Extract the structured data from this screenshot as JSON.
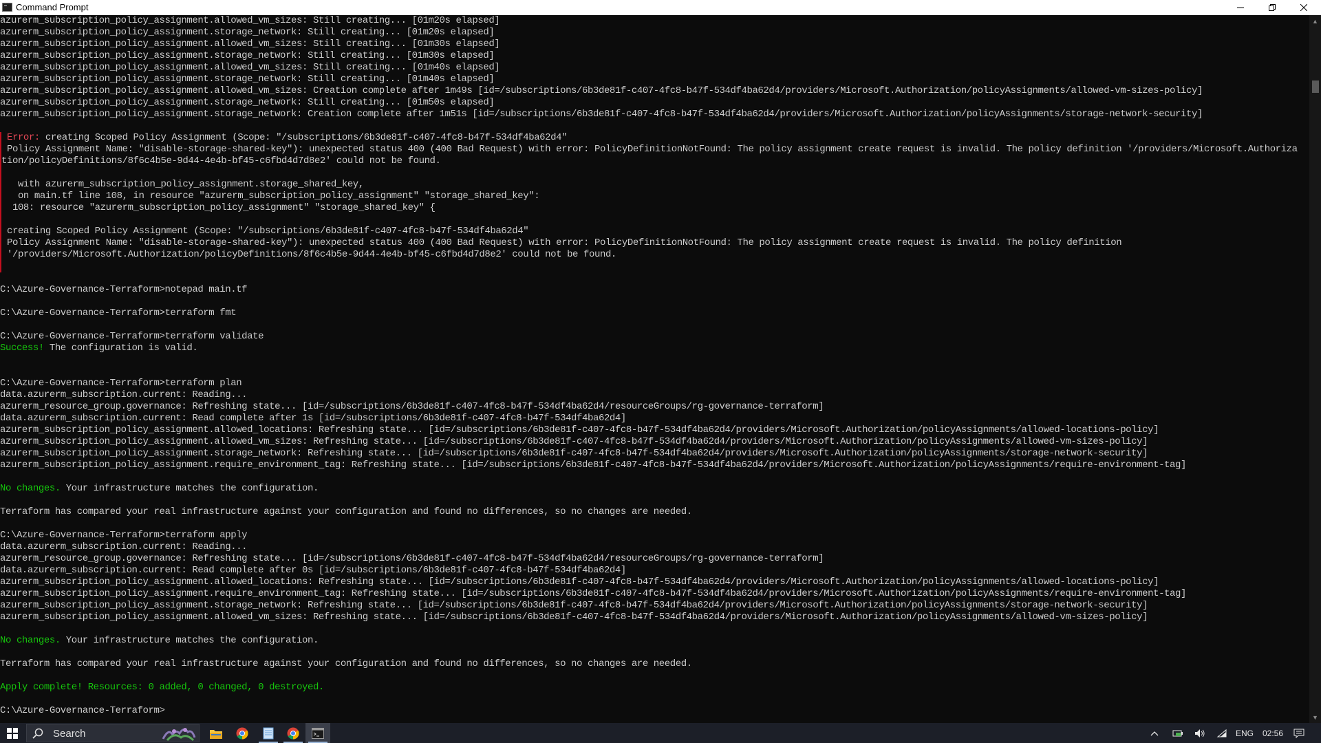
{
  "window": {
    "title": "Command Prompt"
  },
  "console_lines": [
    {
      "segments": [
        {
          "t": "azurerm_subscription_policy_assignment.allowed_vm_sizes: Still creating... [01m20s elapsed]"
        }
      ]
    },
    {
      "segments": [
        {
          "t": "azurerm_subscription_policy_assignment.storage_network: Still creating... [01m20s elapsed]"
        }
      ]
    },
    {
      "segments": [
        {
          "t": "azurerm_subscription_policy_assignment.allowed_vm_sizes: Still creating... [01m30s elapsed]"
        }
      ]
    },
    {
      "segments": [
        {
          "t": "azurerm_subscription_policy_assignment.storage_network: Still creating... [01m30s elapsed]"
        }
      ]
    },
    {
      "segments": [
        {
          "t": "azurerm_subscription_policy_assignment.allowed_vm_sizes: Still creating... [01m40s elapsed]"
        }
      ]
    },
    {
      "segments": [
        {
          "t": "azurerm_subscription_policy_assignment.storage_network: Still creating... [01m40s elapsed]"
        }
      ]
    },
    {
      "segments": [
        {
          "t": "azurerm_subscription_policy_assignment.allowed_vm_sizes: Creation complete after 1m49s [id=/subscriptions/6b3de81f-c407-4fc8-b47f-534df4ba62d4/providers/Microsoft.Authorization/policyAssignments/allowed-vm-sizes-policy]"
        }
      ]
    },
    {
      "segments": [
        {
          "t": "azurerm_subscription_policy_assignment.storage_network: Still creating... [01m50s elapsed]"
        }
      ]
    },
    {
      "segments": [
        {
          "t": "azurerm_subscription_policy_assignment.storage_network: Creation complete after 1m51s [id=/subscriptions/6b3de81f-c407-4fc8-b47f-534df4ba62d4/providers/Microsoft.Authorization/policyAssignments/storage-network-security]"
        }
      ]
    },
    {
      "segments": [
        {
          "t": ""
        }
      ]
    },
    {
      "err": true,
      "segments": [
        {
          "t": " "
        },
        {
          "t": "Error:",
          "c": "red"
        },
        {
          "t": " creating Scoped Policy Assignment (Scope: \"/subscriptions/6b3de81f-c407-4fc8-b47f-534df4ba62d4\""
        }
      ]
    },
    {
      "err": true,
      "segments": [
        {
          "t": " Policy Assignment Name: \"disable-storage-shared-key\"): unexpected status 400 (400 Bad Request) with error: PolicyDefinitionNotFound: The policy assignment create request is invalid. The policy definition '/providers/Microsoft.Authoriza"
        }
      ]
    },
    {
      "err": true,
      "segments": [
        {
          "t": "tion/policyDefinitions/8f6c4b5e-9d44-4e4b-bf45-c6fbd4d7d8e2' could not be found."
        }
      ]
    },
    {
      "err": true,
      "segments": [
        {
          "t": ""
        }
      ]
    },
    {
      "err": true,
      "segments": [
        {
          "t": "   with azurerm_subscription_policy_assignment.storage_shared_key,"
        }
      ]
    },
    {
      "err": true,
      "segments": [
        {
          "t": "   on main.tf line 108, in resource \"azurerm_subscription_policy_assignment\" \"storage_shared_key\":"
        }
      ]
    },
    {
      "err": true,
      "segments": [
        {
          "t": "  108: resource \"azurerm_subscription_policy_assignment\" \"storage_shared_key\" {"
        }
      ]
    },
    {
      "err": true,
      "segments": [
        {
          "t": ""
        }
      ]
    },
    {
      "err": true,
      "segments": [
        {
          "t": " creating Scoped Policy Assignment (Scope: \"/subscriptions/6b3de81f-c407-4fc8-b47f-534df4ba62d4\""
        }
      ]
    },
    {
      "err": true,
      "segments": [
        {
          "t": " Policy Assignment Name: \"disable-storage-shared-key\"): unexpected status 400 (400 Bad Request) with error: PolicyDefinitionNotFound: The policy assignment create request is invalid. The policy definition"
        }
      ]
    },
    {
      "err": true,
      "segments": [
        {
          "t": " '/providers/Microsoft.Authorization/policyDefinitions/8f6c4b5e-9d44-4e4b-bf45-c6fbd4d7d8e2' could not be found."
        }
      ]
    },
    {
      "err": true,
      "segments": [
        {
          "t": ""
        }
      ]
    },
    {
      "segments": [
        {
          "t": ""
        }
      ]
    },
    {
      "segments": [
        {
          "t": "C:\\Azure-Governance-Terraform>notepad main.tf"
        }
      ]
    },
    {
      "segments": [
        {
          "t": ""
        }
      ]
    },
    {
      "segments": [
        {
          "t": "C:\\Azure-Governance-Terraform>terraform fmt"
        }
      ]
    },
    {
      "segments": [
        {
          "t": ""
        }
      ]
    },
    {
      "segments": [
        {
          "t": "C:\\Azure-Governance-Terraform>terraform validate"
        }
      ]
    },
    {
      "segments": [
        {
          "t": "Success!",
          "c": "green"
        },
        {
          "t": " The configuration is valid."
        }
      ]
    },
    {
      "segments": [
        {
          "t": ""
        }
      ]
    },
    {
      "segments": [
        {
          "t": ""
        }
      ]
    },
    {
      "segments": [
        {
          "t": "C:\\Azure-Governance-Terraform>terraform plan"
        }
      ]
    },
    {
      "segments": [
        {
          "t": "data.azurerm_subscription.current: Reading..."
        }
      ]
    },
    {
      "segments": [
        {
          "t": "azurerm_resource_group.governance: Refreshing state... [id=/subscriptions/6b3de81f-c407-4fc8-b47f-534df4ba62d4/resourceGroups/rg-governance-terraform]"
        }
      ]
    },
    {
      "segments": [
        {
          "t": "data.azurerm_subscription.current: Read complete after 1s [id=/subscriptions/6b3de81f-c407-4fc8-b47f-534df4ba62d4]"
        }
      ]
    },
    {
      "segments": [
        {
          "t": "azurerm_subscription_policy_assignment.allowed_locations: Refreshing state... [id=/subscriptions/6b3de81f-c407-4fc8-b47f-534df4ba62d4/providers/Microsoft.Authorization/policyAssignments/allowed-locations-policy]"
        }
      ]
    },
    {
      "segments": [
        {
          "t": "azurerm_subscription_policy_assignment.allowed_vm_sizes: Refreshing state... [id=/subscriptions/6b3de81f-c407-4fc8-b47f-534df4ba62d4/providers/Microsoft.Authorization/policyAssignments/allowed-vm-sizes-policy]"
        }
      ]
    },
    {
      "segments": [
        {
          "t": "azurerm_subscription_policy_assignment.storage_network: Refreshing state... [id=/subscriptions/6b3de81f-c407-4fc8-b47f-534df4ba62d4/providers/Microsoft.Authorization/policyAssignments/storage-network-security]"
        }
      ]
    },
    {
      "segments": [
        {
          "t": "azurerm_subscription_policy_assignment.require_environment_tag: Refreshing state... [id=/subscriptions/6b3de81f-c407-4fc8-b47f-534df4ba62d4/providers/Microsoft.Authorization/policyAssignments/require-environment-tag]"
        }
      ]
    },
    {
      "segments": [
        {
          "t": ""
        }
      ]
    },
    {
      "segments": [
        {
          "t": "No changes.",
          "c": "green"
        },
        {
          "t": " Your infrastructure matches the configuration."
        }
      ]
    },
    {
      "segments": [
        {
          "t": ""
        }
      ]
    },
    {
      "segments": [
        {
          "t": "Terraform has compared your real infrastructure against your configuration and found no differences, so no changes are needed."
        }
      ]
    },
    {
      "segments": [
        {
          "t": ""
        }
      ]
    },
    {
      "segments": [
        {
          "t": "C:\\Azure-Governance-Terraform>terraform apply"
        }
      ]
    },
    {
      "segments": [
        {
          "t": "data.azurerm_subscription.current: Reading..."
        }
      ]
    },
    {
      "segments": [
        {
          "t": "azurerm_resource_group.governance: Refreshing state... [id=/subscriptions/6b3de81f-c407-4fc8-b47f-534df4ba62d4/resourceGroups/rg-governance-terraform]"
        }
      ]
    },
    {
      "segments": [
        {
          "t": "data.azurerm_subscription.current: Read complete after 0s [id=/subscriptions/6b3de81f-c407-4fc8-b47f-534df4ba62d4]"
        }
      ]
    },
    {
      "segments": [
        {
          "t": "azurerm_subscription_policy_assignment.allowed_locations: Refreshing state... [id=/subscriptions/6b3de81f-c407-4fc8-b47f-534df4ba62d4/providers/Microsoft.Authorization/policyAssignments/allowed-locations-policy]"
        }
      ]
    },
    {
      "segments": [
        {
          "t": "azurerm_subscription_policy_assignment.require_environment_tag: Refreshing state... [id=/subscriptions/6b3de81f-c407-4fc8-b47f-534df4ba62d4/providers/Microsoft.Authorization/policyAssignments/require-environment-tag]"
        }
      ]
    },
    {
      "segments": [
        {
          "t": "azurerm_subscription_policy_assignment.storage_network: Refreshing state... [id=/subscriptions/6b3de81f-c407-4fc8-b47f-534df4ba62d4/providers/Microsoft.Authorization/policyAssignments/storage-network-security]"
        }
      ]
    },
    {
      "segments": [
        {
          "t": "azurerm_subscription_policy_assignment.allowed_vm_sizes: Refreshing state... [id=/subscriptions/6b3de81f-c407-4fc8-b47f-534df4ba62d4/providers/Microsoft.Authorization/policyAssignments/allowed-vm-sizes-policy]"
        }
      ]
    },
    {
      "segments": [
        {
          "t": ""
        }
      ]
    },
    {
      "segments": [
        {
          "t": "No changes.",
          "c": "green"
        },
        {
          "t": " Your infrastructure matches the configuration."
        }
      ]
    },
    {
      "segments": [
        {
          "t": ""
        }
      ]
    },
    {
      "segments": [
        {
          "t": "Terraform has compared your real infrastructure against your configuration and found no differences, so no changes are needed."
        }
      ]
    },
    {
      "segments": [
        {
          "t": ""
        }
      ]
    },
    {
      "segments": [
        {
          "t": "Apply complete! Resources: 0 added, 0 changed, 0 destroyed.",
          "c": "green"
        }
      ]
    },
    {
      "segments": [
        {
          "t": ""
        }
      ]
    },
    {
      "segments": [
        {
          "t": "C:\\Azure-Governance-Terraform>"
        }
      ]
    }
  ],
  "taskbar": {
    "search_placeholder": "Search",
    "pinned": [
      "file-explorer",
      "chrome",
      "notepad",
      "chrome",
      "command-prompt"
    ],
    "tray": {
      "language": "ENG",
      "time": "02:56"
    }
  },
  "colors": {
    "console_bg": "#0c0c0c",
    "console_text": "#cccccc",
    "error_red": "#e74856",
    "success_green": "#16c60c",
    "taskbar_bg": "#1c1f28"
  }
}
